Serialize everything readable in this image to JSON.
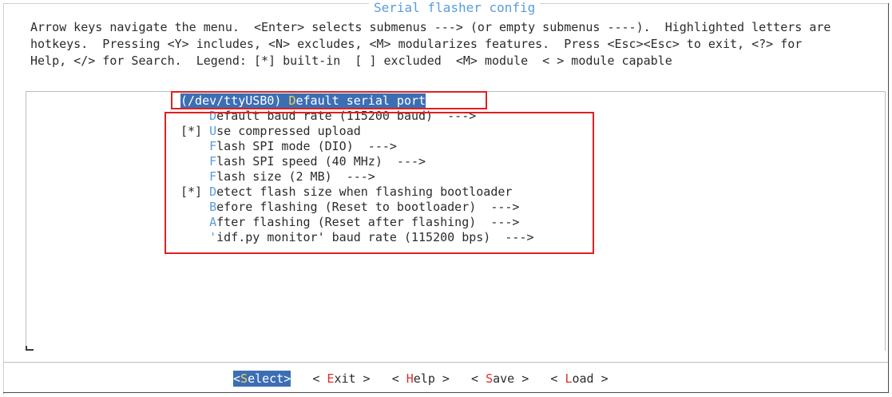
{
  "window": {
    "title": "Serial flasher config"
  },
  "help": {
    "lines": [
      "Arrow keys navigate the menu.  <Enter> selects submenus ---> (or empty submenus ----).  Highlighted letters are",
      "hotkeys.  Pressing <Y> includes, <N> excludes, <M> modularizes features.  Press <Esc><Esc> to exit, <?> for",
      "Help, </> for Search.  Legend: [*] built-in  [ ] excluded  <M> module  < > module capable"
    ]
  },
  "menu": {
    "items": [
      {
        "prefix": "(/dev/ttyUSB0) ",
        "hotkey": "D",
        "rest": "efault serial port",
        "selected": true
      },
      {
        "prefix": "    ",
        "hotkey": "D",
        "rest": "efault baud rate (115200 baud)  --->"
      },
      {
        "prefix": "[*] ",
        "hotkey": "U",
        "rest": "se compressed upload"
      },
      {
        "prefix": "    ",
        "hotkey": "F",
        "rest": "lash SPI mode (DIO)  --->"
      },
      {
        "prefix": "    ",
        "hotkey": "F",
        "rest": "lash SPI speed (40 MHz)  --->"
      },
      {
        "prefix": "    ",
        "hotkey": "F",
        "rest": "lash size (2 MB)  --->"
      },
      {
        "prefix": "[*] ",
        "hotkey": "D",
        "rest": "etect flash size when flashing bootloader"
      },
      {
        "prefix": "    ",
        "hotkey": "B",
        "rest": "efore flashing (Reset to bootloader)  --->"
      },
      {
        "prefix": "    ",
        "hotkey": "A",
        "rest": "fter flashing (Reset after flashing)  --->"
      },
      {
        "prefix": "    ",
        "hotkey": "'",
        "rest": "idf.py monitor' baud rate (115200 bps)  --->"
      }
    ]
  },
  "buttons": {
    "select": {
      "open": "<",
      "hotkey": "S",
      "rest": "elect",
      "close": ">"
    },
    "exit": {
      "open": "< ",
      "hotkey": "E",
      "rest": "xit",
      "close": " >"
    },
    "help": {
      "open": "< ",
      "hotkey": "H",
      "rest": "elp",
      "close": " >"
    },
    "save": {
      "open": "< ",
      "hotkey": "S",
      "rest": "ave",
      "close": " >"
    },
    "load": {
      "open": "< ",
      "hotkey": "L",
      "rest": "oad",
      "close": " >"
    }
  },
  "colors": {
    "title": "#5a9ddb",
    "hotkey": "#5a9ddb",
    "selection_bg": "#3c6eb4",
    "selection_hotkey": "#f2d44e",
    "button_hotkey": "#d9302b",
    "annotation_box": "#e02020"
  }
}
